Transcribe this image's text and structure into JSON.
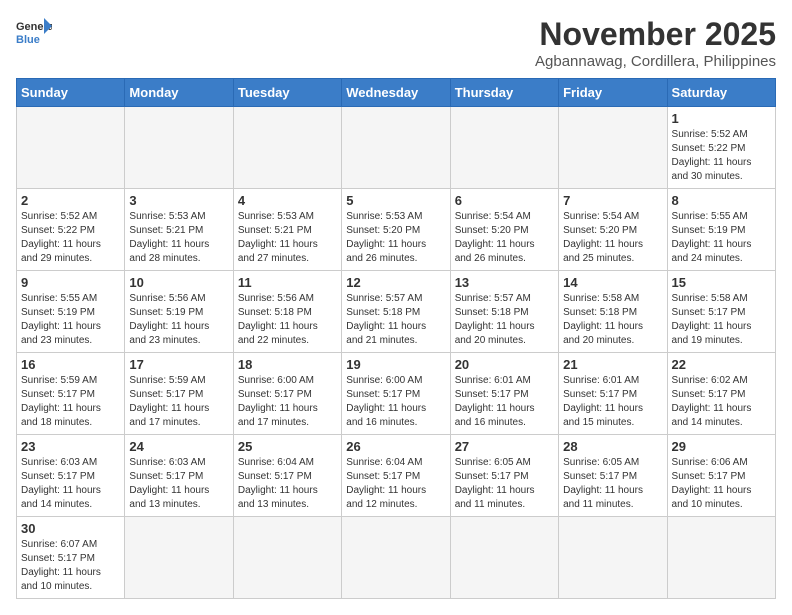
{
  "header": {
    "logo_general": "General",
    "logo_blue": "Blue",
    "month_title": "November 2025",
    "location": "Agbannawag, Cordillera, Philippines"
  },
  "weekdays": [
    "Sunday",
    "Monday",
    "Tuesday",
    "Wednesday",
    "Thursday",
    "Friday",
    "Saturday"
  ],
  "weeks": [
    [
      {
        "day": "",
        "info": ""
      },
      {
        "day": "",
        "info": ""
      },
      {
        "day": "",
        "info": ""
      },
      {
        "day": "",
        "info": ""
      },
      {
        "day": "",
        "info": ""
      },
      {
        "day": "",
        "info": ""
      },
      {
        "day": "1",
        "info": "Sunrise: 5:52 AM\nSunset: 5:22 PM\nDaylight: 11 hours\nand 30 minutes."
      }
    ],
    [
      {
        "day": "2",
        "info": "Sunrise: 5:52 AM\nSunset: 5:22 PM\nDaylight: 11 hours\nand 29 minutes."
      },
      {
        "day": "3",
        "info": "Sunrise: 5:53 AM\nSunset: 5:21 PM\nDaylight: 11 hours\nand 28 minutes."
      },
      {
        "day": "4",
        "info": "Sunrise: 5:53 AM\nSunset: 5:21 PM\nDaylight: 11 hours\nand 27 minutes."
      },
      {
        "day": "5",
        "info": "Sunrise: 5:53 AM\nSunset: 5:20 PM\nDaylight: 11 hours\nand 26 minutes."
      },
      {
        "day": "6",
        "info": "Sunrise: 5:54 AM\nSunset: 5:20 PM\nDaylight: 11 hours\nand 26 minutes."
      },
      {
        "day": "7",
        "info": "Sunrise: 5:54 AM\nSunset: 5:20 PM\nDaylight: 11 hours\nand 25 minutes."
      },
      {
        "day": "8",
        "info": "Sunrise: 5:55 AM\nSunset: 5:19 PM\nDaylight: 11 hours\nand 24 minutes."
      }
    ],
    [
      {
        "day": "9",
        "info": "Sunrise: 5:55 AM\nSunset: 5:19 PM\nDaylight: 11 hours\nand 23 minutes."
      },
      {
        "day": "10",
        "info": "Sunrise: 5:56 AM\nSunset: 5:19 PM\nDaylight: 11 hours\nand 23 minutes."
      },
      {
        "day": "11",
        "info": "Sunrise: 5:56 AM\nSunset: 5:18 PM\nDaylight: 11 hours\nand 22 minutes."
      },
      {
        "day": "12",
        "info": "Sunrise: 5:57 AM\nSunset: 5:18 PM\nDaylight: 11 hours\nand 21 minutes."
      },
      {
        "day": "13",
        "info": "Sunrise: 5:57 AM\nSunset: 5:18 PM\nDaylight: 11 hours\nand 20 minutes."
      },
      {
        "day": "14",
        "info": "Sunrise: 5:58 AM\nSunset: 5:18 PM\nDaylight: 11 hours\nand 20 minutes."
      },
      {
        "day": "15",
        "info": "Sunrise: 5:58 AM\nSunset: 5:17 PM\nDaylight: 11 hours\nand 19 minutes."
      }
    ],
    [
      {
        "day": "16",
        "info": "Sunrise: 5:59 AM\nSunset: 5:17 PM\nDaylight: 11 hours\nand 18 minutes."
      },
      {
        "day": "17",
        "info": "Sunrise: 5:59 AM\nSunset: 5:17 PM\nDaylight: 11 hours\nand 17 minutes."
      },
      {
        "day": "18",
        "info": "Sunrise: 6:00 AM\nSunset: 5:17 PM\nDaylight: 11 hours\nand 17 minutes."
      },
      {
        "day": "19",
        "info": "Sunrise: 6:00 AM\nSunset: 5:17 PM\nDaylight: 11 hours\nand 16 minutes."
      },
      {
        "day": "20",
        "info": "Sunrise: 6:01 AM\nSunset: 5:17 PM\nDaylight: 11 hours\nand 16 minutes."
      },
      {
        "day": "21",
        "info": "Sunrise: 6:01 AM\nSunset: 5:17 PM\nDaylight: 11 hours\nand 15 minutes."
      },
      {
        "day": "22",
        "info": "Sunrise: 6:02 AM\nSunset: 5:17 PM\nDaylight: 11 hours\nand 14 minutes."
      }
    ],
    [
      {
        "day": "23",
        "info": "Sunrise: 6:03 AM\nSunset: 5:17 PM\nDaylight: 11 hours\nand 14 minutes."
      },
      {
        "day": "24",
        "info": "Sunrise: 6:03 AM\nSunset: 5:17 PM\nDaylight: 11 hours\nand 13 minutes."
      },
      {
        "day": "25",
        "info": "Sunrise: 6:04 AM\nSunset: 5:17 PM\nDaylight: 11 hours\nand 13 minutes."
      },
      {
        "day": "26",
        "info": "Sunrise: 6:04 AM\nSunset: 5:17 PM\nDaylight: 11 hours\nand 12 minutes."
      },
      {
        "day": "27",
        "info": "Sunrise: 6:05 AM\nSunset: 5:17 PM\nDaylight: 11 hours\nand 11 minutes."
      },
      {
        "day": "28",
        "info": "Sunrise: 6:05 AM\nSunset: 5:17 PM\nDaylight: 11 hours\nand 11 minutes."
      },
      {
        "day": "29",
        "info": "Sunrise: 6:06 AM\nSunset: 5:17 PM\nDaylight: 11 hours\nand 10 minutes."
      }
    ],
    [
      {
        "day": "30",
        "info": "Sunrise: 6:07 AM\nSunset: 5:17 PM\nDaylight: 11 hours\nand 10 minutes."
      },
      {
        "day": "",
        "info": ""
      },
      {
        "day": "",
        "info": ""
      },
      {
        "day": "",
        "info": ""
      },
      {
        "day": "",
        "info": ""
      },
      {
        "day": "",
        "info": ""
      },
      {
        "day": "",
        "info": ""
      }
    ]
  ]
}
